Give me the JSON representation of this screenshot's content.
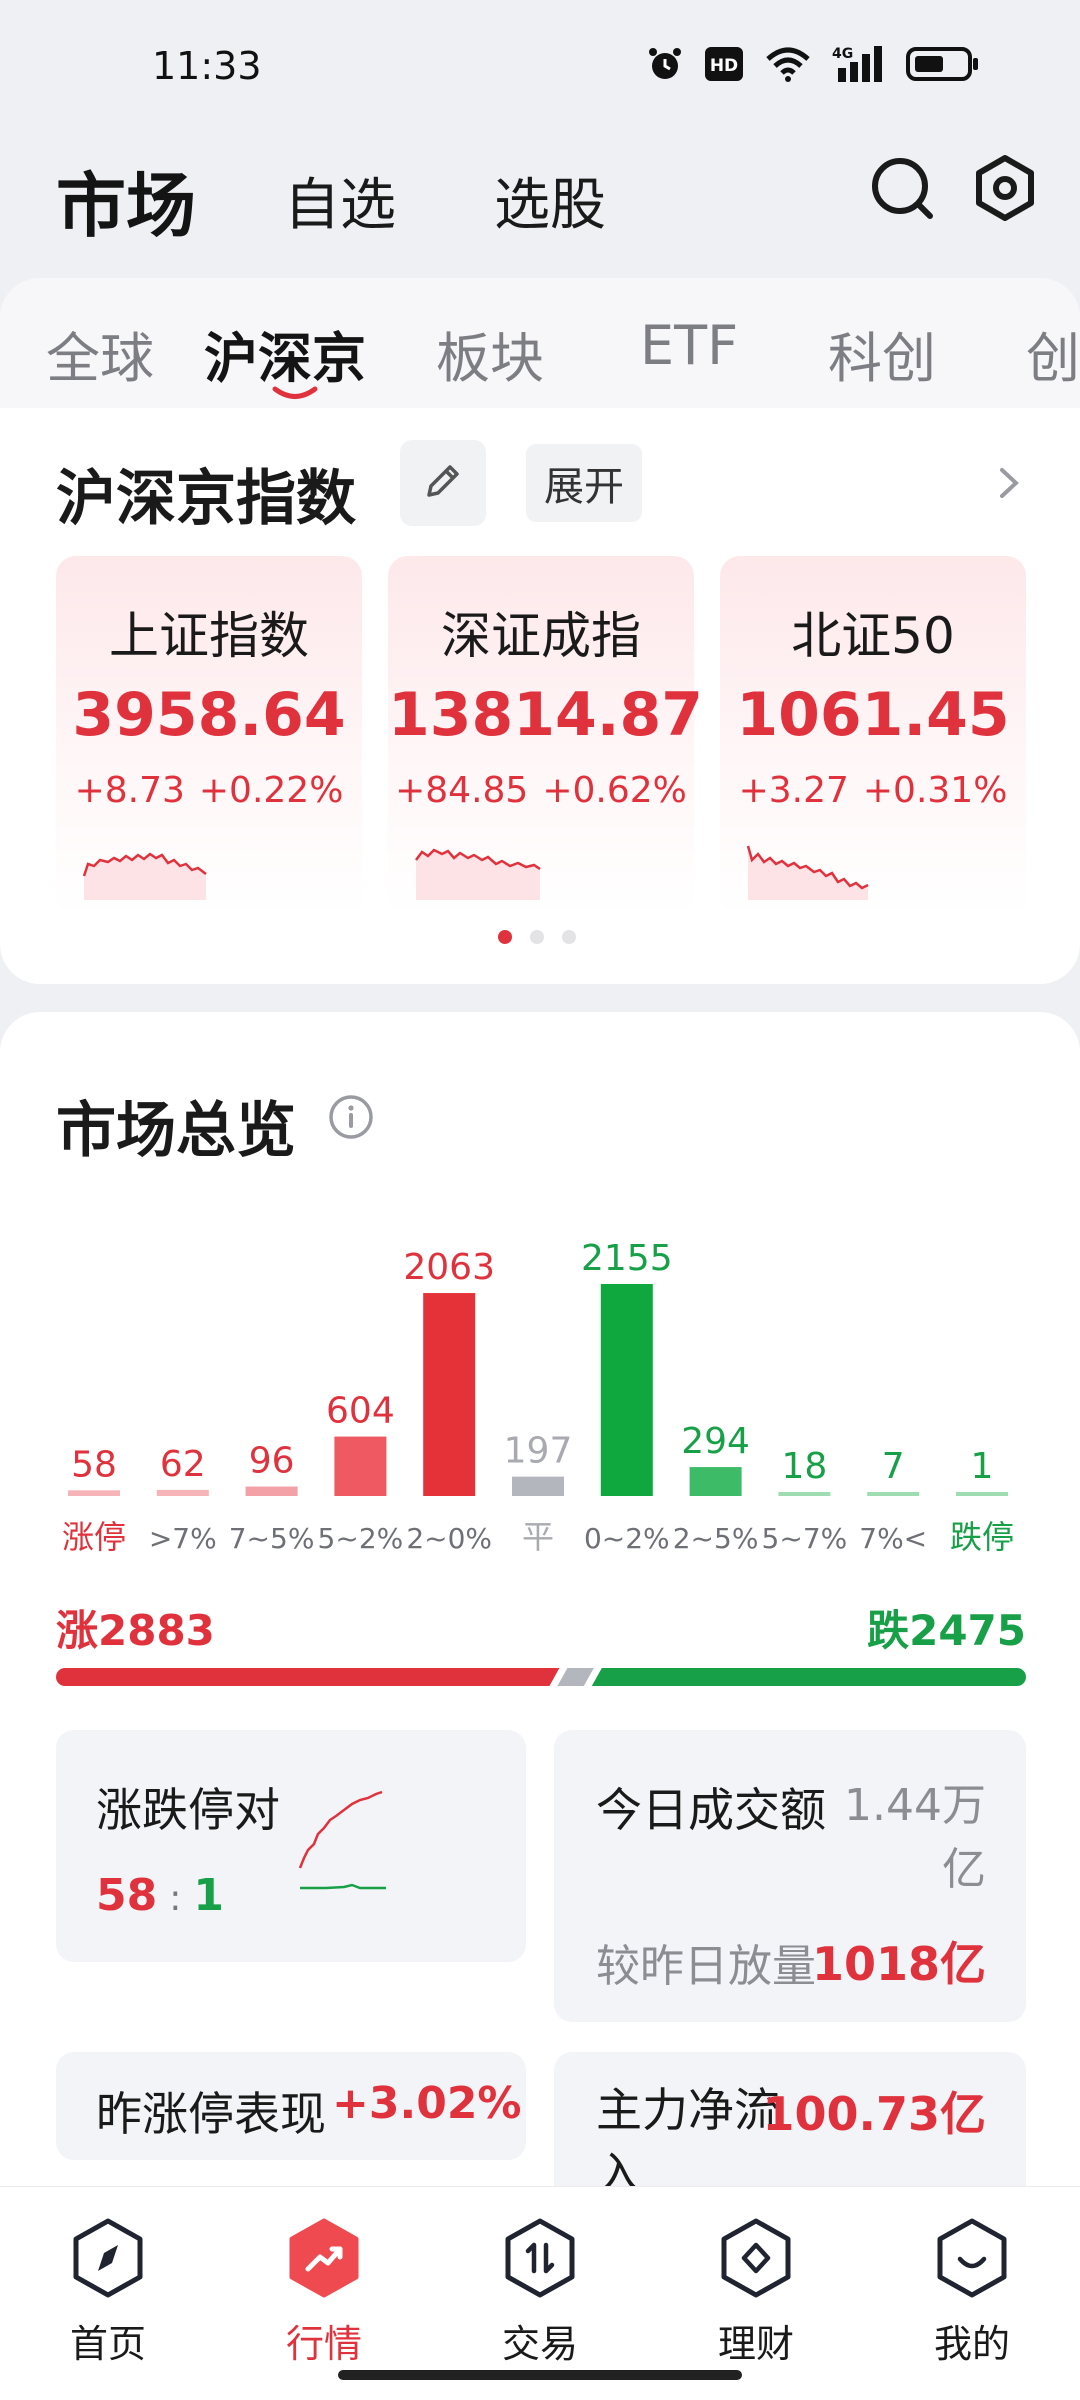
{
  "status_bar": {
    "time": "11:33",
    "network": "4G"
  },
  "header": {
    "title": "市场",
    "tabs": [
      "自选",
      "选股"
    ]
  },
  "sub_tabs": {
    "items": [
      "全球",
      "沪深京",
      "板块",
      "ETF",
      "科创",
      "创"
    ],
    "active": "沪深京"
  },
  "index_section": {
    "title": "沪深京指数",
    "expand_label": "展开",
    "cards": [
      {
        "name": "上证指数",
        "value": "3958.64",
        "change": "+8.73",
        "pct": "+0.22%"
      },
      {
        "name": "深证成指",
        "value": "13814.87",
        "change": "+84.85",
        "pct": "+0.62%"
      },
      {
        "name": "北证50",
        "value": "1061.45",
        "change": "+3.27",
        "pct": "+0.31%"
      }
    ],
    "page_count": 3,
    "active_page": 0
  },
  "overview": {
    "title": "市场总览",
    "summary": {
      "up_label": "涨2883",
      "down_label": "跌2475"
    },
    "tiles": {
      "limit_pair": {
        "label": "涨跌停对",
        "up": "58",
        "sep": ":",
        "down": "1"
      },
      "turnover": {
        "label": "今日成交额",
        "amount": "1.44万亿",
        "compare_label": "较昨日放量",
        "compare_value": "1018亿"
      },
      "yesterday_limit": {
        "label": "昨涨停表现",
        "value": "+3.02%"
      },
      "main_flow": {
        "label": "主力净流入",
        "value": "100.73亿"
      }
    }
  },
  "chart_data": {
    "type": "bar",
    "categories": [
      "涨停",
      ">7%",
      "7~5%",
      "5~2%",
      "2~0%",
      "平",
      "0~2%",
      "2~5%",
      "5~7%",
      "7%<",
      "跌停"
    ],
    "values": [
      58,
      62,
      96,
      604,
      2063,
      197,
      2155,
      294,
      18,
      7,
      1
    ],
    "colors": [
      "#f7b4b8",
      "#f7b4b8",
      "#f3a1a6",
      "#ef5a62",
      "#e53238",
      "#b3b6bd",
      "#0fa83f",
      "#3dbb66",
      "#9edcb1",
      "#9edcb1",
      "#9edcb1"
    ],
    "label_colors": [
      "#e0323d",
      "#e0323d",
      "#e0323d",
      "#e0323d",
      "#e0323d",
      "#a8aab0",
      "#18a048",
      "#18a048",
      "#18a048",
      "#18a048",
      "#18a048"
    ]
  },
  "bottom_nav": {
    "items": [
      {
        "label": "首页",
        "icon": "compass-icon"
      },
      {
        "label": "行情",
        "icon": "trend-icon"
      },
      {
        "label": "交易",
        "icon": "exchange-icon"
      },
      {
        "label": "理财",
        "icon": "diamond-icon"
      },
      {
        "label": "我的",
        "icon": "smile-icon"
      }
    ],
    "active": "行情"
  },
  "colors": {
    "up": "#e0323d",
    "down": "#18a048",
    "flat": "#b3b6bd"
  }
}
